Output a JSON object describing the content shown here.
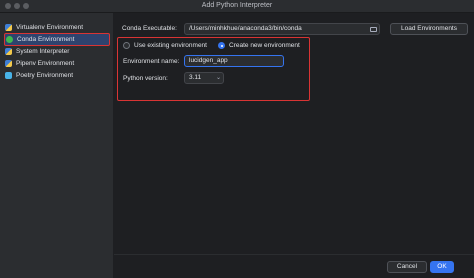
{
  "window": {
    "title": "Add Python Interpreter"
  },
  "sidebar": {
    "items": [
      {
        "label": "Virtualenv Environment",
        "icon": "virtualenv-icon",
        "selected": false
      },
      {
        "label": "Conda Environment",
        "icon": "conda-icon",
        "selected": true
      },
      {
        "label": "System Interpreter",
        "icon": "python-icon",
        "selected": false
      },
      {
        "label": "Pipenv Environment",
        "icon": "pipenv-icon",
        "selected": false
      },
      {
        "label": "Poetry Environment",
        "icon": "poetry-icon",
        "selected": false
      }
    ]
  },
  "main": {
    "conda_executable_label": "Conda Executable:",
    "conda_executable_value": "/Users/minhkhue/anaconda3/bin/conda",
    "load_environments_label": "Load Environments",
    "use_existing_label": "Use existing environment",
    "create_new_label": "Create new environment",
    "create_new_selected": true,
    "environment_name_label": "Environment name:",
    "environment_name_value": "lucidgen_app",
    "python_version_label": "Python version:",
    "python_version_value": "3.11"
  },
  "footer": {
    "cancel_label": "Cancel",
    "ok_label": "OK"
  },
  "colors": {
    "accent": "#3574f0",
    "highlight_border": "#d93434",
    "background": "#1e1f22",
    "panel": "#2b2d30"
  }
}
